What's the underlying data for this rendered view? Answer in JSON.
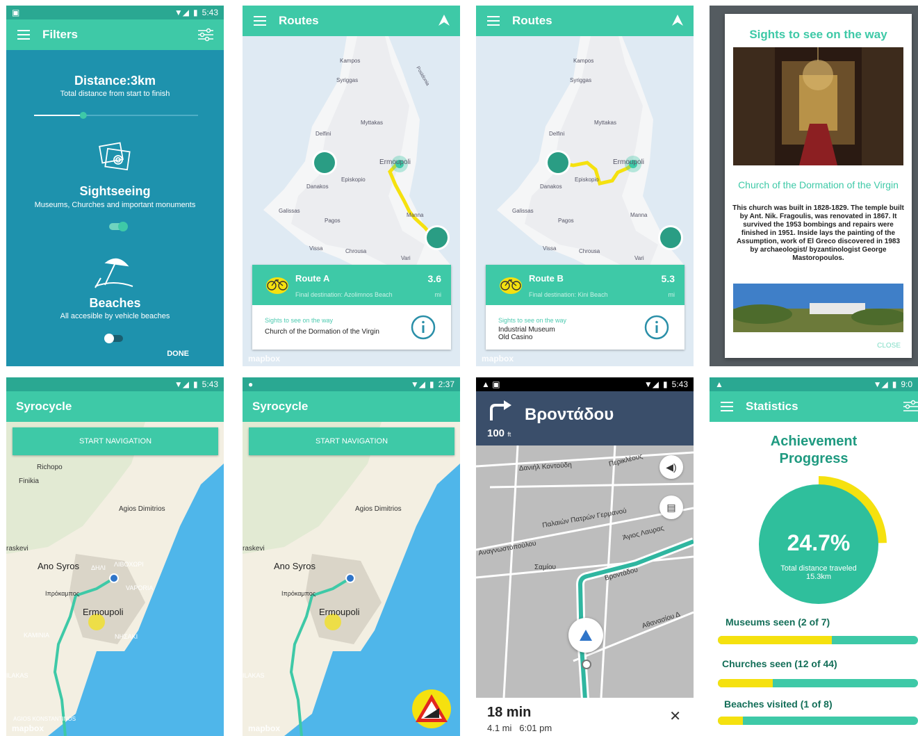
{
  "screen1": {
    "status_time": "5:43",
    "title": "Filters",
    "distance_title": "Distance:3km",
    "distance_sub": "Total distance from start to finish",
    "distance_slider": 0.3,
    "sightseeing_title": "Sightseeing",
    "sightseeing_sub": "Museums, Churches and important monuments",
    "beaches_title": "Beaches",
    "beaches_sub": "All accesible by vehicle beaches",
    "done_label": "DONE"
  },
  "screen2": {
    "title": "Routes",
    "route_name": "Route A",
    "route_distance": "3.6",
    "route_unit": "mi",
    "route_dest": "Final destination: Azolimnos Beach",
    "sights_label": "Sights to see on the way",
    "sights_value": "Church of the Dormation of the Virgin",
    "map_labels": [
      "Kampos",
      "Syriggas",
      "Myttakas",
      "Delfini",
      "Ermoupoli",
      "Episkopio",
      "Danakos",
      "Galissas",
      "Pagos",
      "Vissa",
      "Chrousa",
      "Vari",
      "Manna",
      "Posidonia"
    ],
    "mapbox": "mapbox"
  },
  "screen3": {
    "title": "Routes",
    "route_name": "Route B",
    "route_distance": "5.3",
    "route_unit": "mi",
    "route_dest": "Final destination: Kini Beach",
    "sights_label": "Sights to see on the way",
    "sights_value_1": "Industrial Museum",
    "sights_value_2": "Old Casino",
    "mapbox": "mapbox"
  },
  "screen4": {
    "title": "Sights to see on the way",
    "church_name": "Church of the Dormation of the Virgin",
    "description": "This church was built in 1828-1829. The temple built by Ant. Nik. Fragoulis, was renovated in 1867. It survived the 1953 bombings and repairs were finished in 1951. Inside lays the painting of the Assumption, work of El Greco discovered in 1983 by archaeologist/ byzantinologist George Mastoropoulos.",
    "close_label": "CLOSE"
  },
  "screen5": {
    "status_time": "5:43",
    "title": "Syrocycle",
    "nav_button": "START NAVIGATION",
    "map_labels": [
      "Richopo",
      "Finikia",
      "Agios Dimitrios",
      "raskevi",
      "Ano Syros",
      "ΔΗΛΙ",
      "ΛΙΒΟΧΩΡΙ",
      "VAPORIA",
      "Ermoupoli",
      "Ιπρόκαμπος",
      "KAMINIA",
      "ΝΗΣΑΚΙ",
      "ILAKAS",
      "AGIOS KONSTANTINOS"
    ],
    "mapbox": "mapbox"
  },
  "screen6": {
    "status_time": "2:37",
    "title": "Syrocycle",
    "nav_button": "START NAVIGATION",
    "mapbox": "mapbox"
  },
  "screen7": {
    "status_time": "5:43",
    "street": "Βροντάδου",
    "distance": "100",
    "distance_unit": "ft",
    "eta_min": "18 min",
    "eta_detail": "4.1 mi   6:01 pm",
    "streets": [
      "Δανιήλ Κοντούδη",
      "Περικλέους",
      "Παλαιών Πατρών Γερμανού",
      "Αναγνωστοπούλου",
      "Άγιος Λαυρας",
      "Σαμίου",
      "Βροντάδου",
      "Αθανασίου Δ"
    ]
  },
  "screen8": {
    "status_time": "9:0",
    "title": "Statistics",
    "heading": "Achievement Proggress",
    "percent": "24.7%",
    "percent_value": 0.247,
    "circle_sub": "Total distance traveled",
    "circle_sub2": "15.3km",
    "museums_label": "Museums seen (2 of 7)",
    "museums_progress": 0.571,
    "churches_label": "Churches seen (12 of 44)",
    "churches_progress": 0.273,
    "beaches_label": "Beaches visited (1 of 8)",
    "beaches_progress": 0.125
  },
  "colors": {
    "primary": "#3ec9a7",
    "filter_bg": "#1e92ad",
    "route_yellow": "#f5e10f",
    "nav_dark": "#3a4e6a",
    "water": "#4fb6ea"
  }
}
